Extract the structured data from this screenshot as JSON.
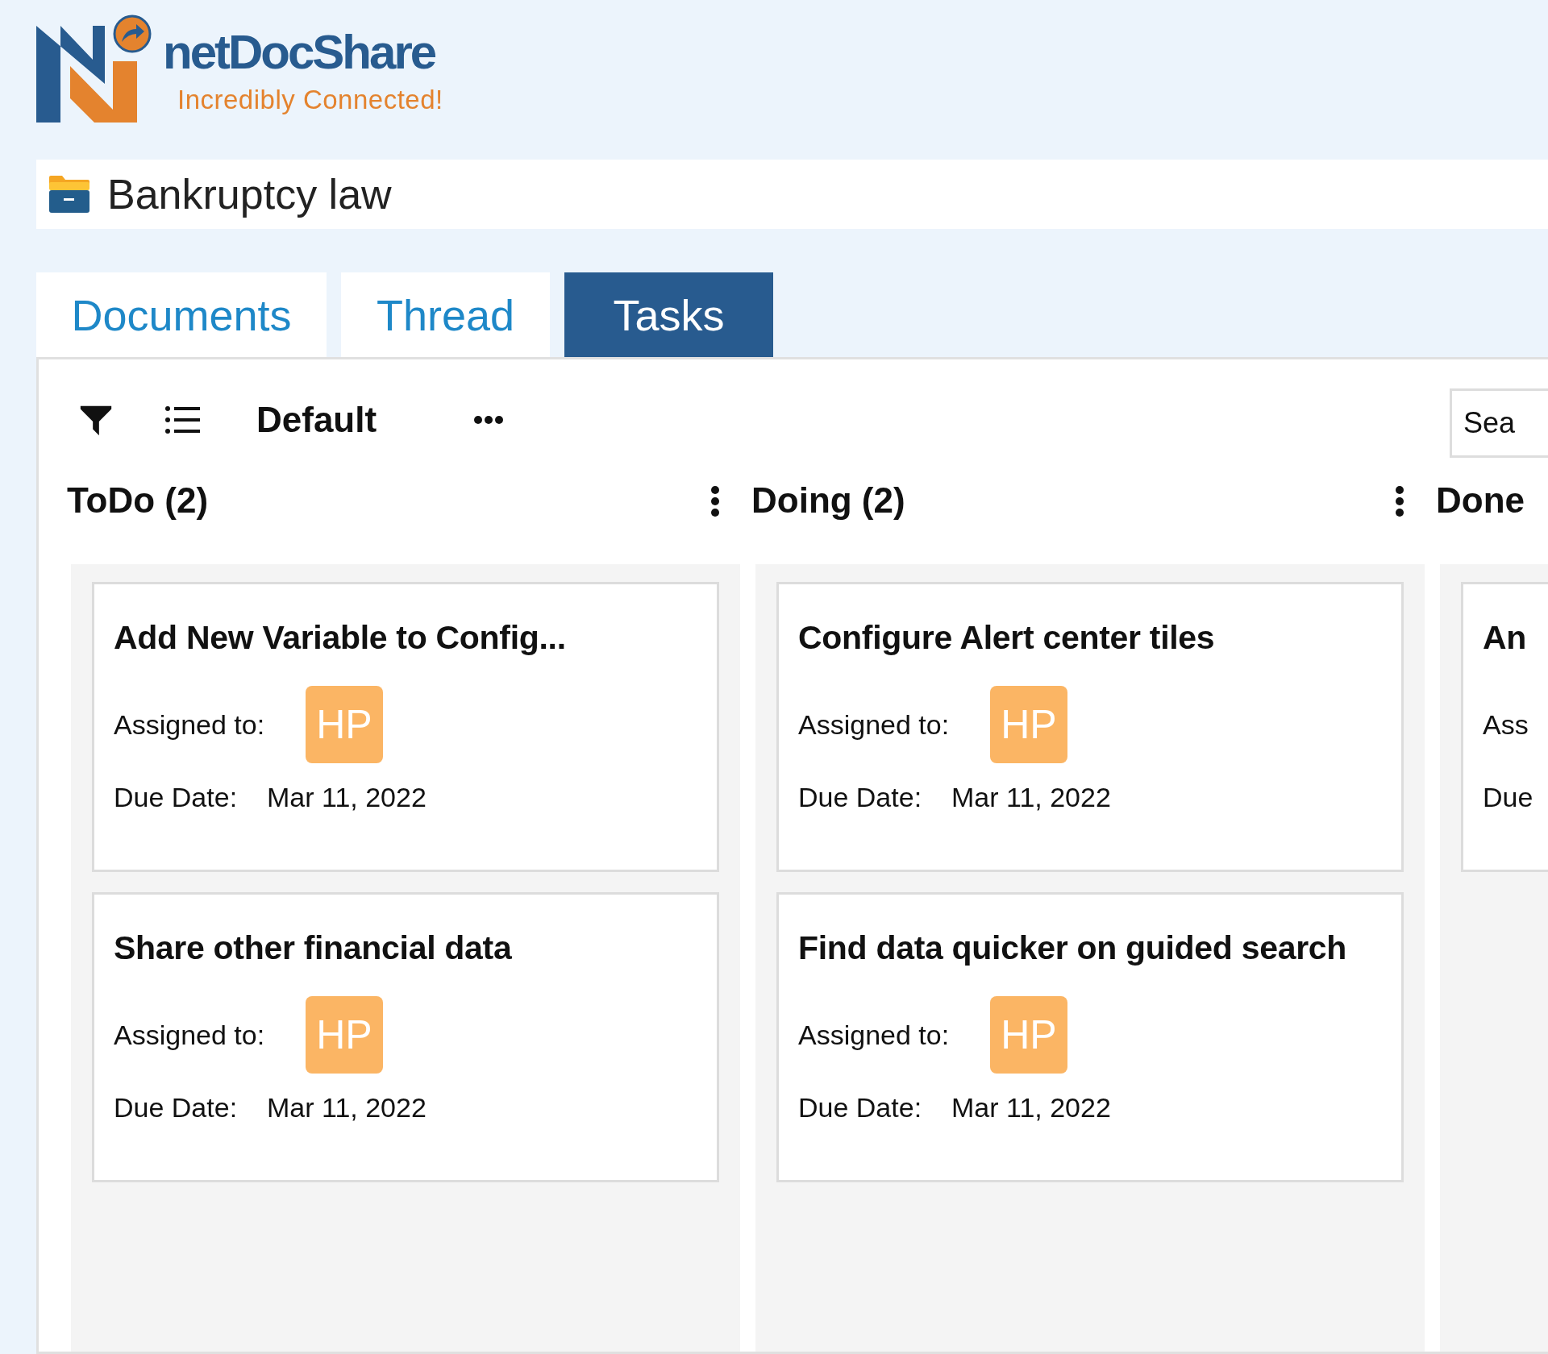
{
  "brand": {
    "name": "netDocShare",
    "tagline": "Incredibly Connected!"
  },
  "workspace": {
    "title": "Bankruptcy law"
  },
  "tabs": [
    {
      "label": "Documents",
      "selected": false
    },
    {
      "label": "Thread",
      "selected": false
    },
    {
      "label": "Tasks",
      "selected": true
    }
  ],
  "toolbar": {
    "view": "Default",
    "search": {
      "placeholder": "Sea"
    }
  },
  "columns": [
    {
      "title": "ToDo (2)",
      "cards": [
        {
          "title": "Add New Variable to Config...",
          "assigned_label": "Assigned to:",
          "assignee": "HP",
          "due_label": "Due Date:",
          "due_date": "Mar 11, 2022"
        },
        {
          "title": "Share other financial data",
          "assigned_label": "Assigned to:",
          "assignee": "HP",
          "due_label": "Due Date:",
          "due_date": "Mar 11, 2022"
        }
      ]
    },
    {
      "title": "Doing (2)",
      "cards": [
        {
          "title": "Configure Alert center tiles",
          "assigned_label": "Assigned to:",
          "assignee": "HP",
          "due_label": "Due Date:",
          "due_date": "Mar 11, 2022"
        },
        {
          "title": "Find data quicker on guided search",
          "assigned_label": "Assigned to:",
          "assignee": "HP",
          "due_label": "Due Date:",
          "due_date": "Mar 11, 2022"
        }
      ]
    },
    {
      "title": "Done",
      "cards": [
        {
          "title": "An",
          "assigned_label": "Ass",
          "due_label": "Due"
        }
      ]
    }
  ]
}
